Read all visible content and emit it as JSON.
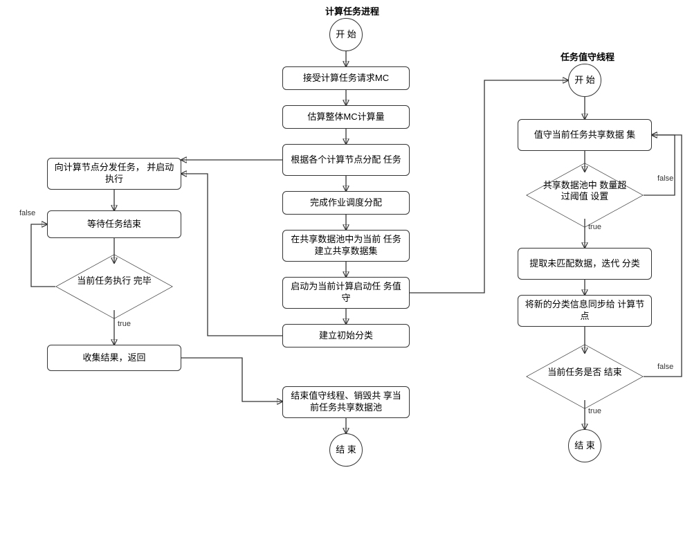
{
  "titles": {
    "main": "计算任务进程",
    "daemon": "任务值守线程"
  },
  "terminals": {
    "start1": "开\n始",
    "end1": "结\n束",
    "start2": "开\n始",
    "end2": "结\n束"
  },
  "main_flow": {
    "b1": "接受计算任务请求MC",
    "b2": "估算整体MC计算量",
    "b3": "根据各个计算节点分配\n任务",
    "b4": "完成作业调度分配",
    "b5": "在共享数据池中为当前\n任务建立共享数据集",
    "b6": "启动为当前计算启动任\n务值守",
    "b7": "建立初始分类",
    "b8": "结束值守线程、销毁共\n享当前任务共享数据池"
  },
  "left_flow": {
    "l1": "向计算节点分发任务，\n并启动执行",
    "l2": "等待任务结束",
    "ld": "当前任务执行\n完毕",
    "l3": "收集结果，返回"
  },
  "right_flow": {
    "r1": "值守当前任务共享数据\n集",
    "rd1": "共享数据池中\n数量超过阈值\n设置",
    "r2": "提取未匹配数据，迭代\n分类",
    "r3": "将新的分类信息同步给\n计算节点",
    "rd2": "当前任务是否\n结束"
  },
  "labels": {
    "true": "true",
    "false": "false"
  }
}
